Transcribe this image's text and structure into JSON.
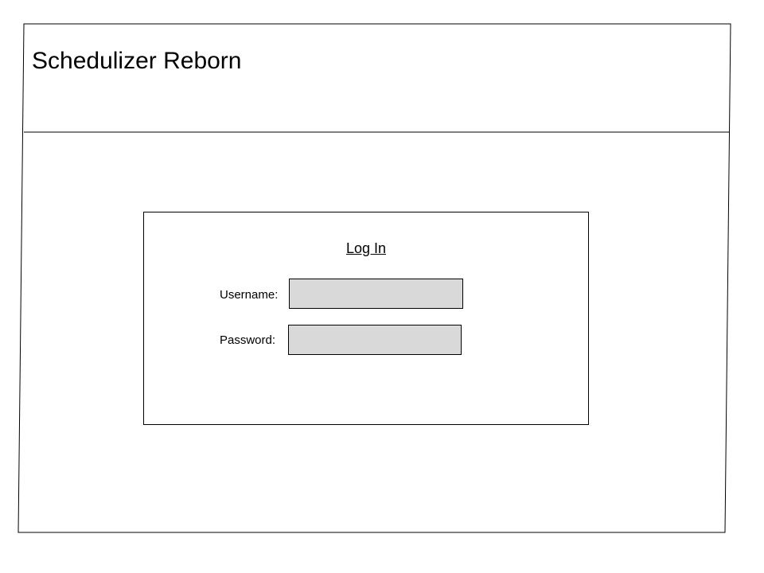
{
  "app": {
    "title": "Schedulizer Reborn"
  },
  "login": {
    "heading": "Log In",
    "username": {
      "label": "Username:",
      "value": ""
    },
    "password": {
      "label": "Password:",
      "value": ""
    }
  },
  "colors": {
    "stroke": "#000000",
    "input_fill": "#d9d9d9",
    "background": "#ffffff"
  }
}
